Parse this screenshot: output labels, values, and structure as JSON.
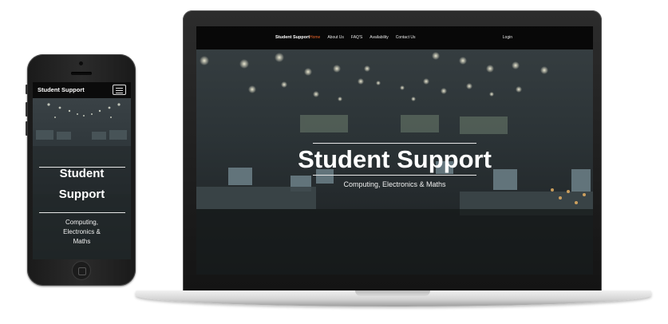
{
  "site": {
    "brand": "Student Support",
    "nav_links": [
      "Home",
      "About Us",
      "FAQ'S",
      "Availability",
      "Contact Us"
    ],
    "active_link": "Home",
    "login_label": "Login",
    "hero_title": "Student Support",
    "hero_subtitle": "Computing, Electronics & Maths",
    "accent_color": "#e9642a"
  },
  "mobile": {
    "brand": "Student Support",
    "menu_icon": "hamburger-menu-icon",
    "hero_title_line1": "Student",
    "hero_title_line2": "Support",
    "hero_subtitle_line1": "Computing,",
    "hero_subtitle_line2": "Electronics &",
    "hero_subtitle_line3": "Maths"
  },
  "devices": [
    "smartphone",
    "laptop"
  ]
}
